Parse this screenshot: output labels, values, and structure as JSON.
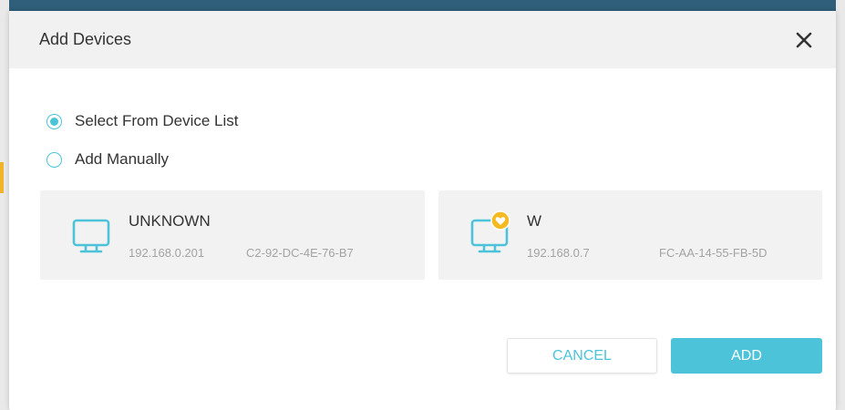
{
  "dialog": {
    "title": "Add Devices",
    "close_icon": "close-icon"
  },
  "options": {
    "select_from_list": "Select From Device List",
    "add_manually": "Add Manually",
    "selected": "select_from_list"
  },
  "devices": [
    {
      "name": "UNKNOWN",
      "ip": "192.168.0.201",
      "mac": "C2-92-DC-4E-76-B7",
      "icon": "monitor-icon"
    },
    {
      "name": "W",
      "ip": "192.168.0.7",
      "mac": "FC-AA-14-55-FB-5D",
      "icon": "monitor-icon",
      "badge_icon": "heart-badge-icon"
    }
  ],
  "buttons": {
    "cancel": "CANCEL",
    "add": "ADD"
  },
  "colors": {
    "accent": "#4cc3d9",
    "badge": "#f5b921",
    "header_bg": "#f1f1f1",
    "card_bg": "#f2f2f2"
  }
}
